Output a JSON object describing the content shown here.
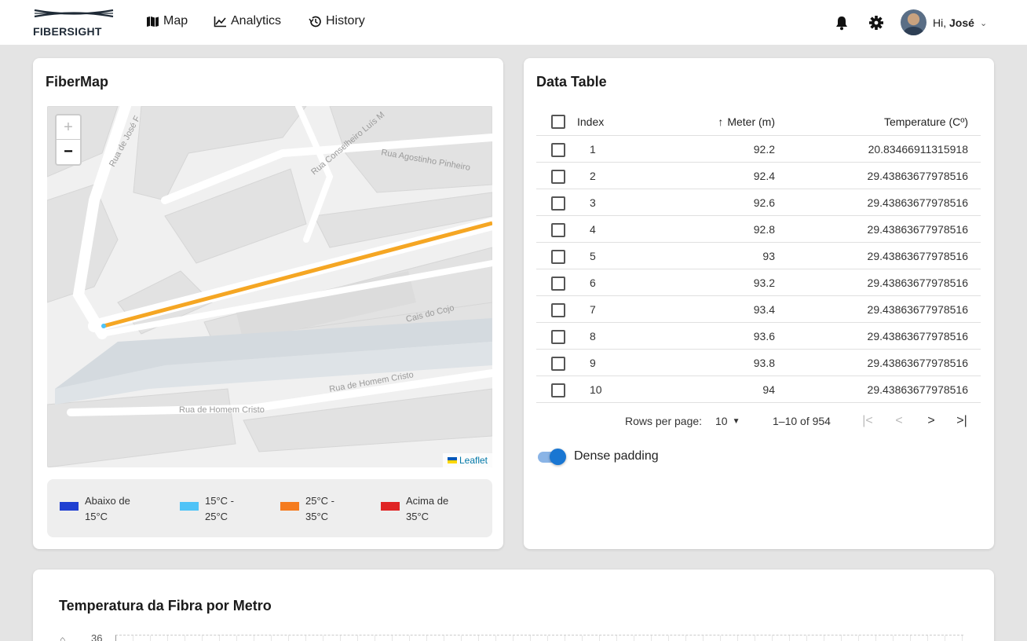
{
  "brand": {
    "name": "FIBERSIGHT"
  },
  "nav": [
    {
      "label": "Map",
      "icon": "map-icon"
    },
    {
      "label": "Analytics",
      "icon": "chart-line-icon"
    },
    {
      "label": "History",
      "icon": "history-icon"
    }
  ],
  "user": {
    "greeting": "Hi, ",
    "name": "José"
  },
  "map_card": {
    "title": "FiberMap",
    "streets": [
      "Rua de José F",
      "Rua Conselheiro Luís M",
      "Rua Agostinho Pinheiro",
      "Cais do Cojo",
      "Rua de Homem Cristo",
      "Rua de Homem Cristo"
    ],
    "attribution": "Leaflet",
    "zoom_in": "+",
    "zoom_out": "−",
    "fiber_color": "#f5a623",
    "legend": [
      {
        "label": "Abaixo de 15°C",
        "color": "#1f3fd1"
      },
      {
        "label": "15°C - 25°C",
        "color": "#4fc3f7"
      },
      {
        "label": "25°C - 35°C",
        "color": "#f57c1f"
      },
      {
        "label": "Acima de 35°C",
        "color": "#e02424"
      }
    ]
  },
  "table_card": {
    "title": "Data Table",
    "columns": {
      "index": "Index",
      "meter": "Meter (m)",
      "temperature": "Temperature (Cº)",
      "sort_arrow": "↑"
    },
    "rows": [
      {
        "index": "1",
        "meter": "92.2",
        "temperature": "20.83466911315918"
      },
      {
        "index": "2",
        "meter": "92.4",
        "temperature": "29.43863677978516"
      },
      {
        "index": "3",
        "meter": "92.6",
        "temperature": "29.43863677978516"
      },
      {
        "index": "4",
        "meter": "92.8",
        "temperature": "29.43863677978516"
      },
      {
        "index": "5",
        "meter": "93",
        "temperature": "29.43863677978516"
      },
      {
        "index": "6",
        "meter": "93.2",
        "temperature": "29.43863677978516"
      },
      {
        "index": "7",
        "meter": "93.4",
        "temperature": "29.43863677978516"
      },
      {
        "index": "8",
        "meter": "93.6",
        "temperature": "29.43863677978516"
      },
      {
        "index": "9",
        "meter": "93.8",
        "temperature": "29.43863677978516"
      },
      {
        "index": "10",
        "meter": "94",
        "temperature": "29.43863677978516"
      }
    ],
    "pagination": {
      "rows_per_page_label": "Rows per page:",
      "rows_per_page": "10",
      "range": "1–10 of 954"
    },
    "dense_padding": {
      "label": "Dense padding",
      "enabled": true
    }
  },
  "chart_card": {
    "title": "Temperatura da Fibra por Metro",
    "chart_data": {
      "type": "line",
      "y_ticks_visible": [
        "36"
      ]
    }
  },
  "colors": {
    "accent": "#1976d2",
    "background": "#e4e4e4"
  }
}
